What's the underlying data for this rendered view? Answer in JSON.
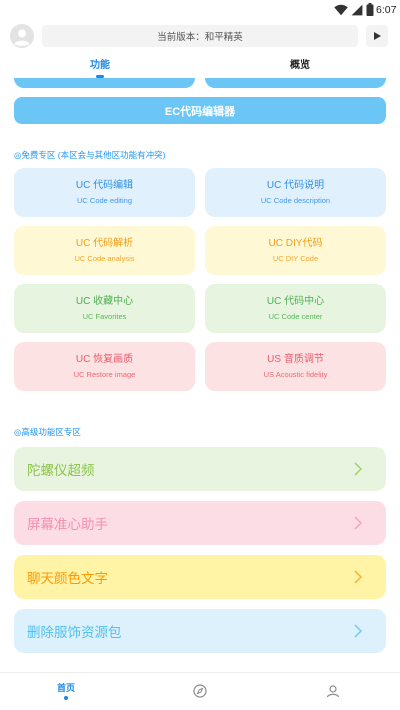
{
  "theme": {
    "accent": "#1E88E5",
    "section_title": "#2196F3",
    "muted_icon": "#8A8A8A"
  },
  "status_bar": {
    "time": "6:07",
    "icons": [
      "wifi-icon",
      "signal-icon",
      "battery-icon"
    ]
  },
  "header": {
    "avatar_icon": "avatar-icon",
    "version_text": "当前版本：和平精英",
    "action_icon": "play-icon"
  },
  "tabs": [
    {
      "label": "功能",
      "selected": true
    },
    {
      "label": "概览",
      "selected": false
    }
  ],
  "partial_buttons": [
    {
      "bg": "#6BC6F6"
    },
    {
      "bg": "#6BC6F6"
    }
  ],
  "ec_button": {
    "label": "EC代码编辑器",
    "bg": "#6BC6F6",
    "fg": "#FFFFFF"
  },
  "free_section": {
    "title": "◎免费专区 (本区会与其他区功能有冲突)",
    "cards": [
      {
        "title": "UC 代码编辑",
        "subtitle": "UC Code editing",
        "bg": "#E1F0FD",
        "fg": "#2F8FE4"
      },
      {
        "title": "UC 代码说明",
        "subtitle": "UC Code description",
        "bg": "#E1F0FD",
        "fg": "#2F8FE4"
      },
      {
        "title": "UC 代码解析",
        "subtitle": "UC Code analysis",
        "bg": "#FFF8D5",
        "fg": "#F39C12"
      },
      {
        "title": "UC DIY代码",
        "subtitle": "UC DIY Code",
        "bg": "#FFF8D5",
        "fg": "#F39C12"
      },
      {
        "title": "UC 收藏中心",
        "subtitle": "UC Favorites",
        "bg": "#E7F4E0",
        "fg": "#4CAF50"
      },
      {
        "title": "UC 代码中心",
        "subtitle": "UC Code center",
        "bg": "#E7F4E0",
        "fg": "#4CAF50"
      },
      {
        "title": "UC 恢复画质",
        "subtitle": "UC Restore image",
        "bg": "#FDE2E4",
        "fg": "#EC5A6B"
      },
      {
        "title": "US 音质调节",
        "subtitle": "US Acoustic fidelity",
        "bg": "#FDE2E4",
        "fg": "#EC5A6B"
      }
    ]
  },
  "advanced_section": {
    "title": "◎高级功能区专区",
    "items": [
      {
        "label": "陀螺仪超频",
        "bg": "#E8F4E0",
        "fg": "#8BC34A",
        "icon": "chevron-right-icon"
      },
      {
        "label": "屏幕准心助手",
        "bg": "#FCDDE6",
        "fg": "#F48FB1",
        "icon": "chevron-right-icon"
      },
      {
        "label": "聊天颜色文字",
        "bg": "#FFF4A6",
        "fg": "#FF9800",
        "icon": "chevron-right-icon"
      },
      {
        "label": "删除服饰资源包",
        "bg": "#DCF1FB",
        "fg": "#4FC0F0",
        "icon": "chevron-right-icon"
      }
    ]
  },
  "bottom_nav": {
    "items": [
      {
        "label": "首页",
        "active": true
      },
      {
        "icon": "compass-icon",
        "active": false
      },
      {
        "icon": "user-icon",
        "active": false
      }
    ]
  }
}
